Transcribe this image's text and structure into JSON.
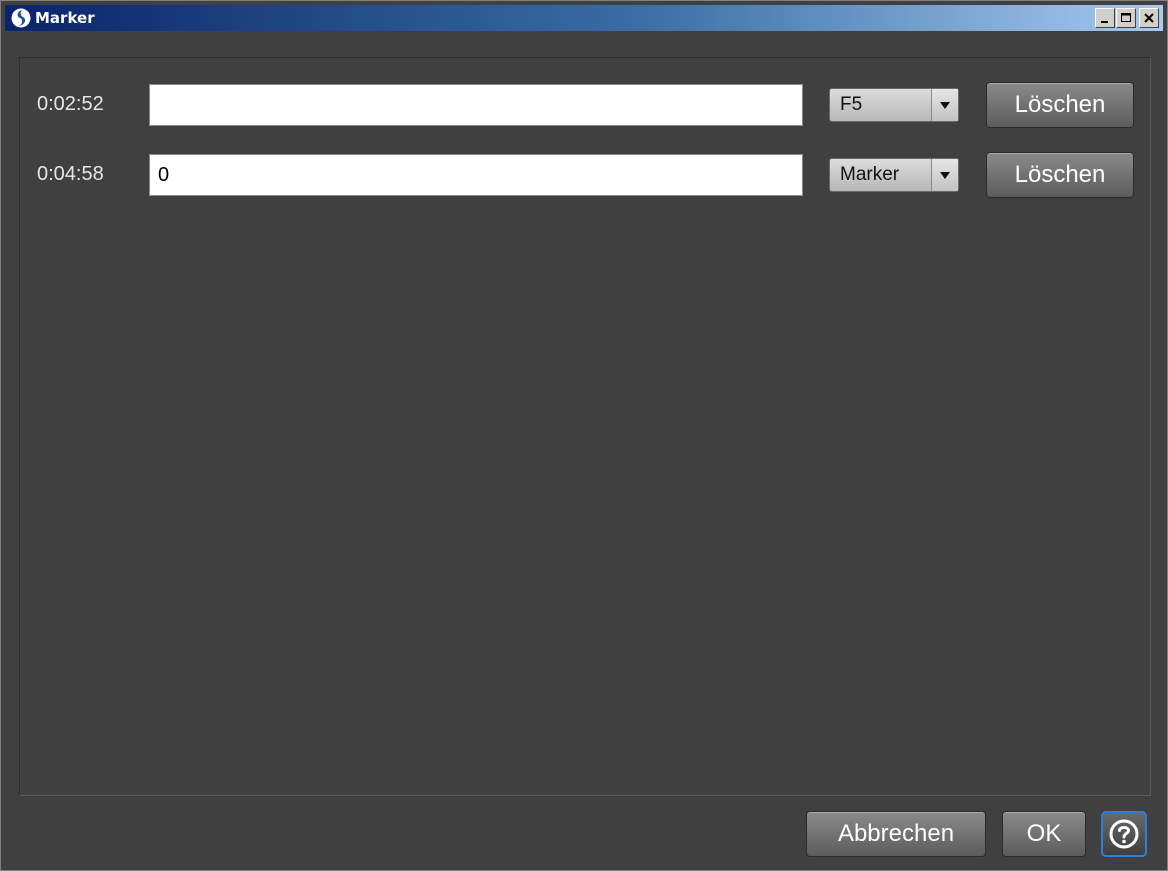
{
  "window": {
    "title": "Marker",
    "controls": [
      "minimize-icon",
      "maximize-icon",
      "close-icon"
    ]
  },
  "markers": [
    {
      "time": "0:02:52",
      "text": "",
      "type": "F5",
      "delete_label": "Löschen"
    },
    {
      "time": "0:04:58",
      "text": "0",
      "type": "Marker",
      "delete_label": "Löschen"
    }
  ],
  "footer": {
    "cancel_label": "Abbrechen",
    "ok_label": "OK",
    "help_icon": "help-icon"
  },
  "colors": {
    "background": "#404040",
    "titlebar_start": "#0a246a",
    "titlebar_end": "#a6caf0",
    "help_border": "#2f7de0"
  }
}
